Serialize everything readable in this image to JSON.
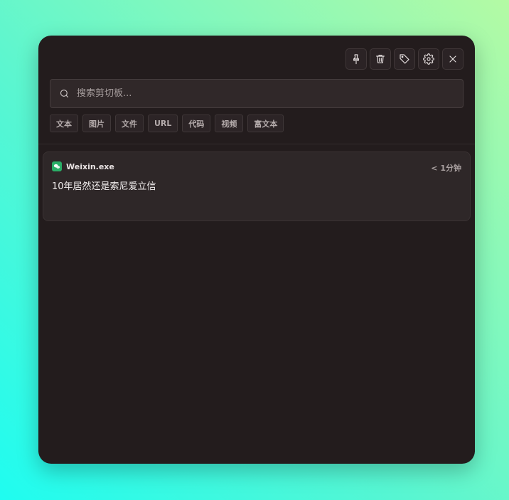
{
  "toolbar": {
    "buttons": [
      {
        "name": "pin",
        "icon": "pin-icon"
      },
      {
        "name": "delete",
        "icon": "trash-icon"
      },
      {
        "name": "tag",
        "icon": "tag-icon"
      },
      {
        "name": "settings",
        "icon": "gear-icon"
      },
      {
        "name": "close",
        "icon": "close-icon"
      }
    ]
  },
  "search": {
    "placeholder": "搜索剪切板...",
    "value": ""
  },
  "filters": [
    "文本",
    "图片",
    "文件",
    "URL",
    "代码",
    "视频",
    "富文本"
  ],
  "items": [
    {
      "app": "Weixin.exe",
      "app_icon": "wechat-icon",
      "app_color": "#2aae67",
      "time": "< 1分钟",
      "content": "10年居然还是索尼爱立信"
    }
  ],
  "colors": {
    "window_bg": "#231c1d",
    "card_bg": "#2e2728",
    "accent_green": "#2aae67"
  }
}
